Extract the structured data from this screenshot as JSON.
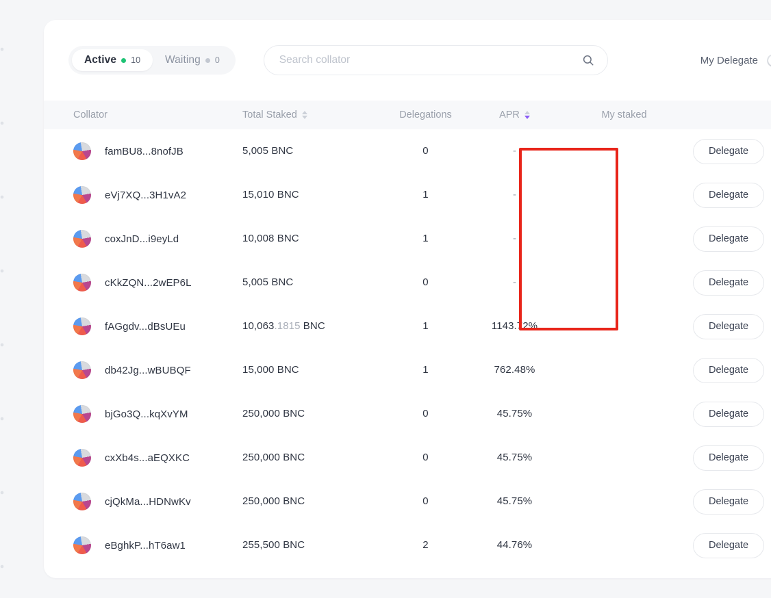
{
  "tabs": [
    {
      "label": "Active",
      "count": "10",
      "active": true,
      "dot_color": "#1fc375"
    },
    {
      "label": "Waiting",
      "count": "0",
      "active": false,
      "dot_color": "#c3c8d1"
    }
  ],
  "search": {
    "placeholder": "Search collator",
    "value": "",
    "icon": "search-icon"
  },
  "my_delegate": {
    "label": "My Delegate",
    "enabled": false
  },
  "table": {
    "columns": [
      {
        "key": "collator",
        "label": "Collator",
        "sortable": false,
        "sort": "none"
      },
      {
        "key": "total",
        "label": "Total Staked",
        "sortable": true,
        "sort": "none"
      },
      {
        "key": "deleg",
        "label": "Delegations",
        "sortable": false,
        "sort": "none"
      },
      {
        "key": "apr",
        "label": "APR",
        "sortable": true,
        "sort": "desc"
      },
      {
        "key": "mystaked",
        "label": "My staked",
        "sortable": false,
        "sort": "none"
      }
    ],
    "action_label": "Delegate",
    "rows": [
      {
        "collator": "famBU8...8nofJB",
        "total_int": "5,005",
        "total_dec": "",
        "total_unit": "BNC",
        "delegations": "0",
        "apr": "-",
        "my_staked": ""
      },
      {
        "collator": "eVj7XQ...3H1vA2",
        "total_int": "15,010",
        "total_dec": "",
        "total_unit": "BNC",
        "delegations": "1",
        "apr": "-",
        "my_staked": ""
      },
      {
        "collator": "coxJnD...i9eyLd",
        "total_int": "10,008",
        "total_dec": "",
        "total_unit": "BNC",
        "delegations": "1",
        "apr": "-",
        "my_staked": ""
      },
      {
        "collator": "cKkZQN...2wEP6L",
        "total_int": "5,005",
        "total_dec": "",
        "total_unit": "BNC",
        "delegations": "0",
        "apr": "-",
        "my_staked": ""
      },
      {
        "collator": "fAGgdv...dBsUEu",
        "total_int": "10,063",
        "total_dec": ".1815",
        "total_unit": "BNC",
        "delegations": "1",
        "apr": "1143.72%",
        "my_staked": ""
      },
      {
        "collator": "db42Jg...wBUBQF",
        "total_int": "15,000",
        "total_dec": "",
        "total_unit": "BNC",
        "delegations": "1",
        "apr": "762.48%",
        "my_staked": ""
      },
      {
        "collator": "bjGo3Q...kqXvYM",
        "total_int": "250,000",
        "total_dec": "",
        "total_unit": "BNC",
        "delegations": "0",
        "apr": "45.75%",
        "my_staked": ""
      },
      {
        "collator": "cxXb4s...aEQXKC",
        "total_int": "250,000",
        "total_dec": "",
        "total_unit": "BNC",
        "delegations": "0",
        "apr": "45.75%",
        "my_staked": ""
      },
      {
        "collator": "cjQkMa...HDNwKv",
        "total_int": "250,000",
        "total_dec": "",
        "total_unit": "BNC",
        "delegations": "0",
        "apr": "45.75%",
        "my_staked": ""
      },
      {
        "collator": "eBghkP...hT6aw1",
        "total_int": "255,500",
        "total_dec": "",
        "total_unit": "BNC",
        "delegations": "2",
        "apr": "44.76%",
        "my_staked": ""
      }
    ]
  },
  "annotation": {
    "color": "#e8251a",
    "target_column": "APR"
  },
  "colors": {
    "page_background": "#f5f6f8",
    "card_background": "#ffffff",
    "header_row": "#f7f8fa",
    "active_dot": "#1fc375",
    "sort_active": "#8b5cf6",
    "annotation": "#e8251a"
  }
}
